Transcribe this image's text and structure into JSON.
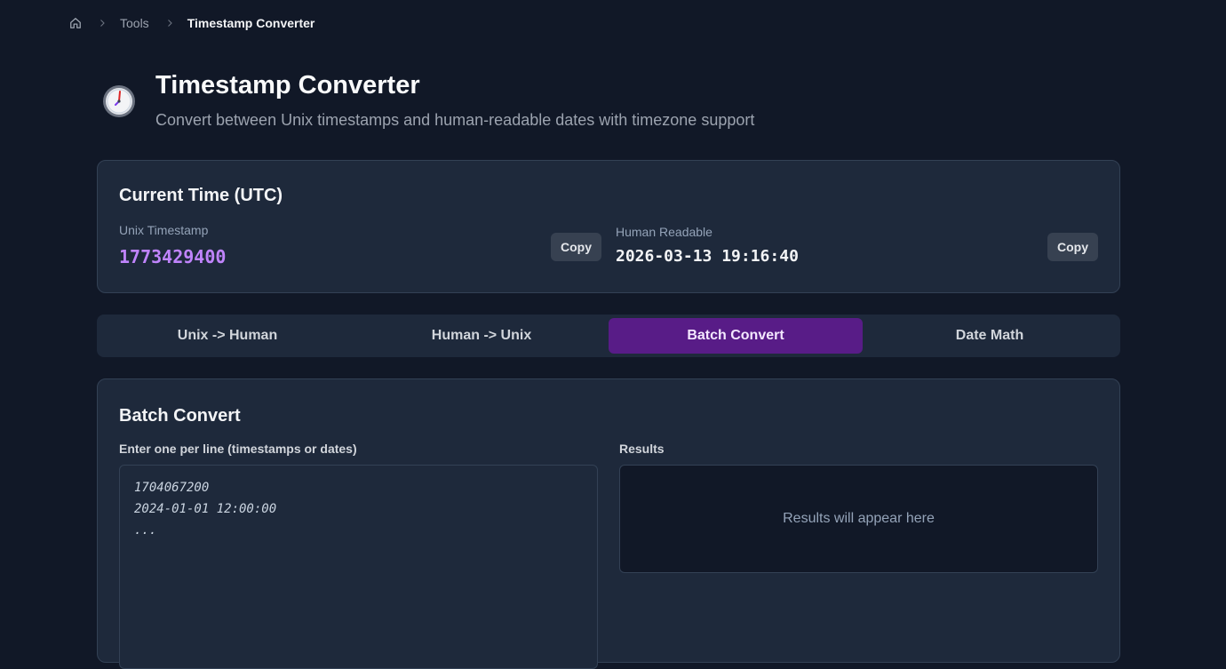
{
  "breadcrumb": {
    "home_icon": "home-icon",
    "separator_icon": "chevron-right-icon",
    "items": [
      "Tools",
      "Timestamp Converter"
    ]
  },
  "header": {
    "icon": "stopwatch-icon",
    "title": "Timestamp Converter",
    "subtitle": "Convert between Unix timestamps and human-readable dates with timezone support"
  },
  "current": {
    "title": "Current Time (UTC)",
    "unix_label": "Unix Timestamp",
    "unix_value": "1773429400",
    "human_label": "Human Readable",
    "human_value": "2026-03-13 19:16:40",
    "copy_label": "Copy"
  },
  "tabs": [
    {
      "label": "Unix -> Human",
      "active": false
    },
    {
      "label": "Human -> Unix",
      "active": false
    },
    {
      "label": "Batch Convert",
      "active": true
    },
    {
      "label": "Date Math",
      "active": false
    }
  ],
  "batch": {
    "title": "Batch Convert",
    "input_label": "Enter one per line (timestamps or dates)",
    "input_placeholder": "1704067200\n2024-01-01 12:00:00\n...",
    "results_label": "Results",
    "results_placeholder": "Results will appear here"
  },
  "colors": {
    "background": "#111827",
    "card": "#1e293b",
    "accent": "#581c87",
    "unix_value": "#c084fc"
  }
}
